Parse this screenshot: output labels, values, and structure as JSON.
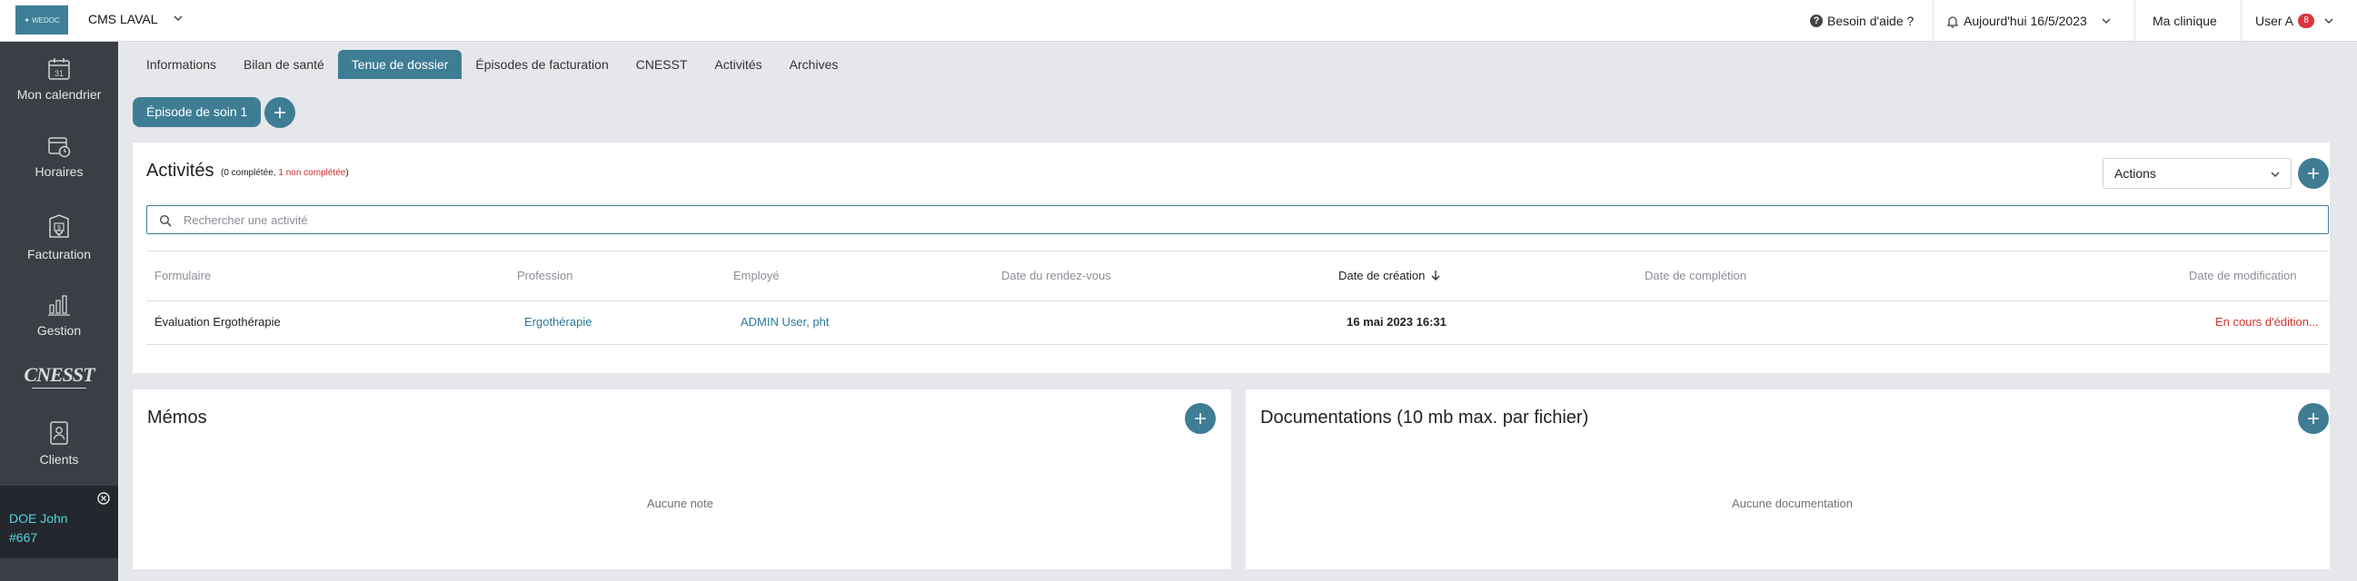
{
  "topbar": {
    "logo_text": "✦ WEDOC",
    "clinic": "CMS LAVAL",
    "help": "Besoin d'aide ?",
    "today": "Aujourd'hui 16/5/2023",
    "my_clinic": "Ma clinique",
    "user": "User A",
    "user_badge": "8"
  },
  "sidebar": {
    "items": [
      {
        "label": "Mon calendrier",
        "icon": "calendar-icon",
        "day": "31"
      },
      {
        "label": "Horaires",
        "icon": "schedule-icon"
      },
      {
        "label": "Facturation",
        "icon": "billing-icon"
      },
      {
        "label": "Gestion",
        "icon": "management-icon"
      },
      {
        "label": "CNESST",
        "icon": "cnesst-logo"
      },
      {
        "label": "Clients",
        "icon": "clients-icon"
      }
    ],
    "patient": {
      "name": "DOE John",
      "number": "#667"
    }
  },
  "tabs": [
    {
      "label": "Informations",
      "active": false
    },
    {
      "label": "Bilan de santé",
      "active": false
    },
    {
      "label": "Tenue de dossier",
      "active": true
    },
    {
      "label": "Épisodes de facturation",
      "active": false
    },
    {
      "label": "CNESST",
      "active": false
    },
    {
      "label": "Activités",
      "active": false
    },
    {
      "label": "Archives",
      "active": false
    }
  ],
  "episode": {
    "label": "Épisode de soin 1"
  },
  "activities": {
    "title": "Activités",
    "summary_open": "(0 complétée, ",
    "summary_incomplete": "1 non complétée",
    "summary_close": ")",
    "actions_label": "Actions",
    "search_placeholder": "Rechercher une activité",
    "columns": [
      "Formulaire",
      "Profession",
      "Employé",
      "Date du rendez-vous",
      "Date de création",
      "Date de complétion",
      "Date de modification"
    ],
    "rows": [
      {
        "formulaire": "Évaluation Ergothérapie",
        "profession": "Ergothérapie",
        "employe": "ADMIN User, pht",
        "date_rdv": "",
        "date_creation": "16 mai 2023 16:31",
        "date_completion": "",
        "date_modification": "En cours d'édition..."
      }
    ]
  },
  "memos": {
    "title": "Mémos",
    "empty": "Aucune note"
  },
  "docs": {
    "title": "Documentations (10 mb max. par fichier)",
    "empty": "Aucune documentation"
  },
  "colors": {
    "accent": "#3f7d95",
    "sidebar": "#3b3e45",
    "danger": "#d0332e",
    "patient": "#4fd6e0"
  }
}
